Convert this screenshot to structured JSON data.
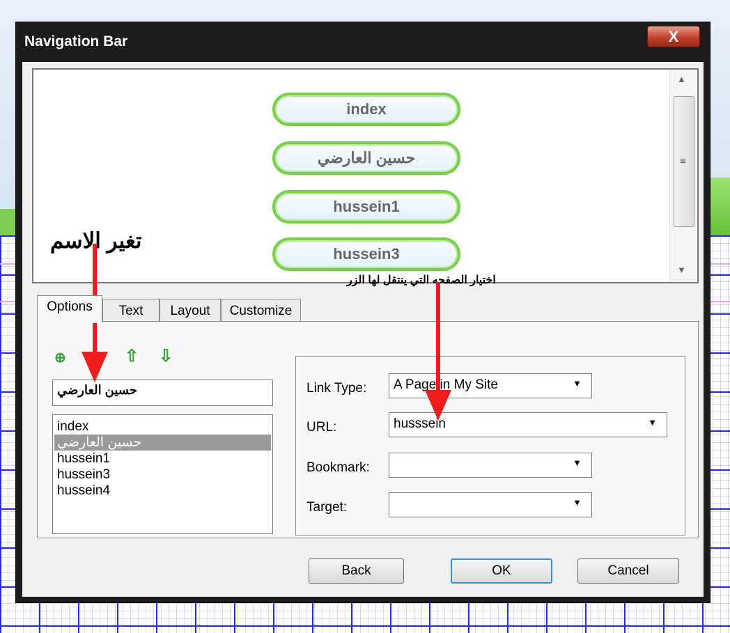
{
  "dialog": {
    "title": "Navigation Bar",
    "close_label": "X"
  },
  "preview": {
    "buttons": [
      "index",
      "حسين العارضي",
      "hussein1",
      "hussein3"
    ]
  },
  "tabs": [
    "Options",
    "Text",
    "Layout",
    "Customize"
  ],
  "options": {
    "name_value": "حسين العارضي",
    "items": [
      "index",
      "حسين العارضي",
      "hussein1",
      "hussein3",
      "hussein4"
    ],
    "selected_index": 1,
    "toolbar_icons": [
      "add-page-icon",
      "delete-icon",
      "move-up-icon",
      "move-down-icon"
    ]
  },
  "link": {
    "link_type_label": "Link Type:",
    "link_type_value": "A Page in My Site",
    "url_label": "URL:",
    "url_value": "husssein",
    "bookmark_label": "Bookmark:",
    "bookmark_value": "",
    "target_label": "Target:",
    "target_value": ""
  },
  "buttons": {
    "back": "Back",
    "ok": "OK",
    "cancel": "Cancel"
  },
  "annotations": {
    "rename": "تغير الاسم",
    "choose_page": "اختيار الصفحه التي ينتقل لها الزر"
  },
  "colors": {
    "arrow": "#ee1c1c",
    "nav_button_border": "#78d04a",
    "grid_line": "#2a2ad8"
  }
}
